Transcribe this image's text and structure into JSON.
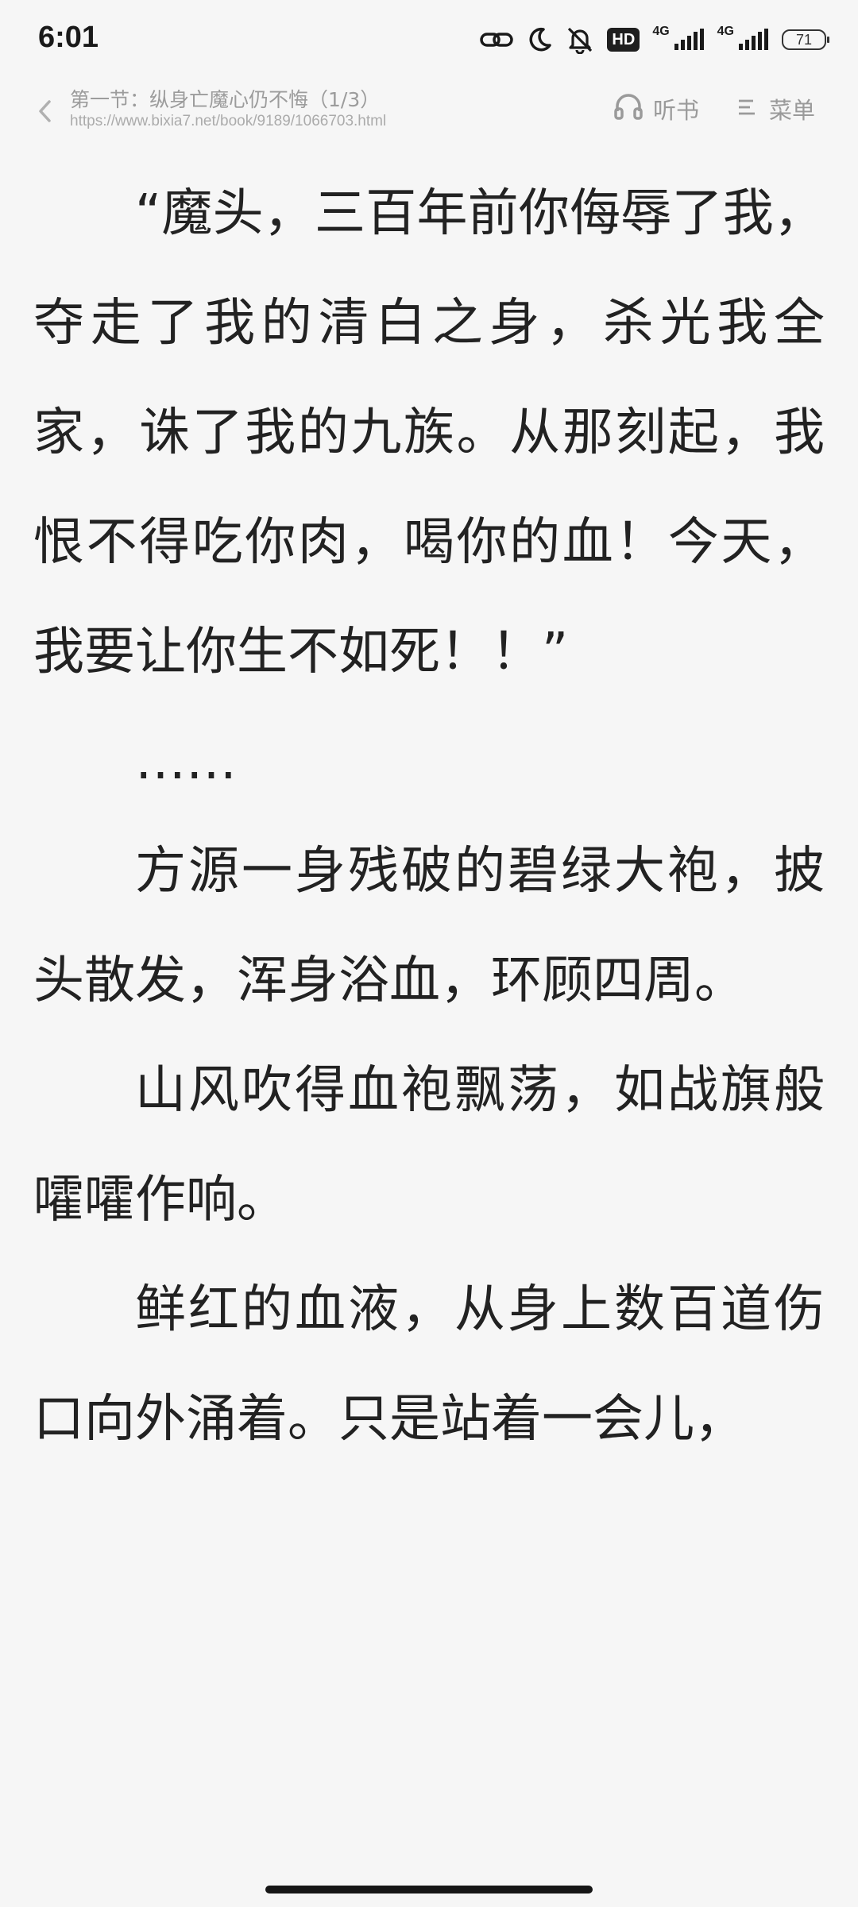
{
  "status_bar": {
    "time": "6:01",
    "hd_label": "HD",
    "network_1": "4G",
    "network_2": "4G",
    "battery": "71",
    "icons": [
      "link-icon",
      "moon-icon",
      "bell-off-icon",
      "hd-icon",
      "signal-icon",
      "signal-icon",
      "battery-icon"
    ]
  },
  "header": {
    "chapter_title": "第一节：纵身亡魔心仍不悔（1/3）",
    "url": "https://www.bixia7.net/book/9189/1066703.html",
    "listen_label": "听书",
    "menu_label": "菜单",
    "icons": [
      "chevron-left-icon",
      "headphones-icon",
      "menu-icon"
    ]
  },
  "content": {
    "paragraphs": [
      "“魔头，三百年前你侮辱了我，夺走了我的清白之身，杀光我全家，诛了我的九族。从那刻起，我恨不得吃你肉，喝你的血！今天，我要让你生不如死！！”",
      "……",
      "方源一身残破的碧绿大袍，披头散发，浑身浴血，环顾四周。",
      "山风吹得血袍飘荡，如战旗般嚯嚯作响。",
      "鲜红的血液，从身上数百道伤口向外涌着。只是站着一会儿，"
    ]
  }
}
